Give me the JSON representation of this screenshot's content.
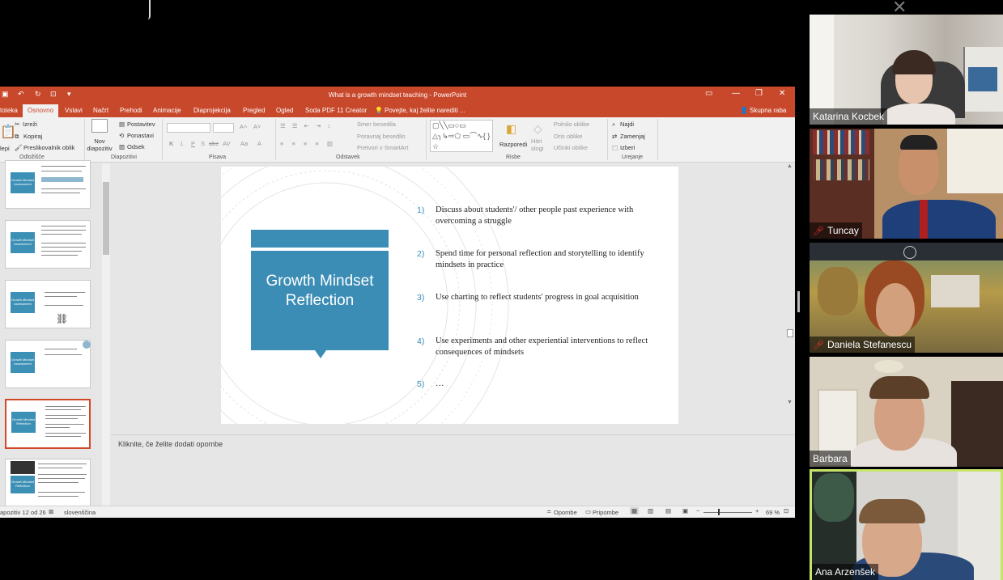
{
  "window": {
    "title": "What is a growth mindset teaching - PowerPoint",
    "qat_icons": [
      "save-icon",
      "undo-icon",
      "redo-icon",
      "present-icon"
    ]
  },
  "tabs": [
    "toteka",
    "Osnovno",
    "Vstavi",
    "Načrt",
    "Prehodi",
    "Animacije",
    "Diaprojekcija",
    "Pregled",
    "Ogled",
    "Soda PDF 11 Creator"
  ],
  "tell_me": "Povejte, kaj želite narediti ...",
  "share": "Skupna raba",
  "ribbon": {
    "clipboard": {
      "paste": "lepi",
      "cut": "Izreži",
      "copy": "Kopiraj",
      "format_painter": "Preslikovalnik oblik",
      "group": "Odložišče"
    },
    "slides": {
      "new_slide": "Nov diapozitiv",
      "layout": "Postavitev",
      "reset": "Ponastavi",
      "section": "Odsek",
      "group": "Diapozitivi"
    },
    "font": {
      "bold": "K",
      "italic": "L",
      "underline": "P",
      "strike": "S",
      "shadow": "abc",
      "spacing": "AV",
      "case": "Aa",
      "group": "Pisava"
    },
    "paragraph": {
      "text_direction": "Smer besedila",
      "align_text": "Poravnaj besedilo",
      "smartart": "Pretvori v SmartArt",
      "group": "Odstavek"
    },
    "drawing": {
      "arrange": "Razporedi",
      "quick_styles": "Hitri slogi",
      "shape_fill": "Polnilo oblike",
      "shape_outline": "Oris oblike",
      "shape_effects": "Učinki oblike",
      "group": "Risbe"
    },
    "editing": {
      "find": "Najdi",
      "replace": "Zamenjaj",
      "select": "Izberi",
      "group": "Urejanje"
    }
  },
  "thumbnails": [
    {
      "title": "Growth Mindset Assessment"
    },
    {
      "title": "Growth Mindset Assessment"
    },
    {
      "title": "Growth Mindset Assessment"
    },
    {
      "title": "Growth Mindset Assessment"
    },
    {
      "title": "Growth Mindset Reflection"
    },
    {
      "title": "Growth Mindset Reflection"
    }
  ],
  "slide": {
    "box_title": "Growth Mindset Reflection",
    "items": [
      {
        "num": "1)",
        "text": "Discuss about students'/ other people past experience with overcoming a struggle"
      },
      {
        "num": "2)",
        "text": "Spend time for personal reflection and storytelling to identify mindsets in practice"
      },
      {
        "num": "3)",
        "text": "Use charting to reflect students' progress in goal acquisition"
      },
      {
        "num": "4)",
        "text": "Use experiments and other experiential interventions to reflect consequences of mindsets"
      },
      {
        "num": "5)",
        "text": "…"
      }
    ]
  },
  "notes_placeholder": "Kliknite, če želite dodati opombe",
  "status": {
    "slide_counter": "apozitiv 12 od 26",
    "language": "slovenščina",
    "notes": "Opombe",
    "comments": "Pripombe",
    "zoom": "69 %"
  },
  "participants": [
    {
      "name": "Katarina Kocbek",
      "muted": false
    },
    {
      "name": "Tuncay",
      "muted": true
    },
    {
      "name": "Daniela Stefanescu",
      "muted": true
    },
    {
      "name": "Barbara",
      "muted": false
    },
    {
      "name": "Ana Arzenšek",
      "muted": false,
      "speaking": true
    }
  ],
  "colors": {
    "ppt_accent": "#c8482b",
    "slide_blue": "#3b8db5",
    "speaker_border": "#c7e46a"
  }
}
